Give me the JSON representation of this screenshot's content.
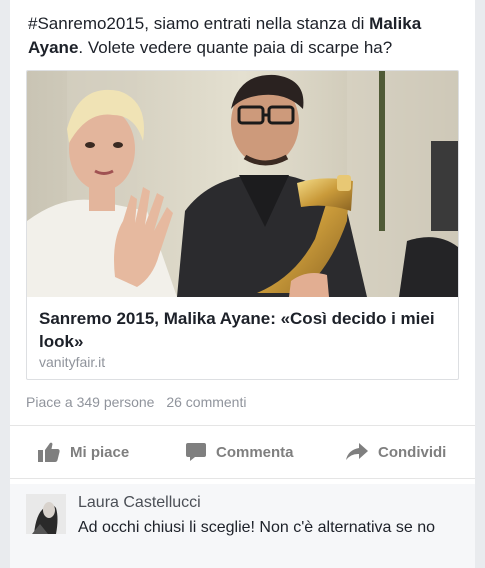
{
  "post": {
    "hashtag": "#Sanremo2015",
    "text_part1": ", siamo entrati nella stanza di ",
    "name_bold": "Malika Ayane",
    "text_part2": ". Volete vedere quante paia di scarpe ha?"
  },
  "link": {
    "title": "Sanremo 2015, Malika Ayane: «Così decido i miei look»",
    "domain": "vanityfair.it",
    "image_icon": "photo-thumbnail"
  },
  "stats": {
    "likes": "Piace a 349 persone",
    "comments": "26 commenti"
  },
  "actions": {
    "like_label": "Mi piace",
    "comment_label": "Commenta",
    "share_label": "Condividi",
    "like_icon": "thumbs-up-icon",
    "comment_icon": "speech-bubble-icon",
    "share_icon": "share-arrow-icon"
  },
  "comment": {
    "author": "Laura Castellucci",
    "text": "Ad occhi chiusi li sceglie! Non c'è alternativa se no"
  },
  "colors": {
    "accent": "#4b67a1",
    "muted": "#90949c",
    "action_gray": "#7f7f7f"
  }
}
